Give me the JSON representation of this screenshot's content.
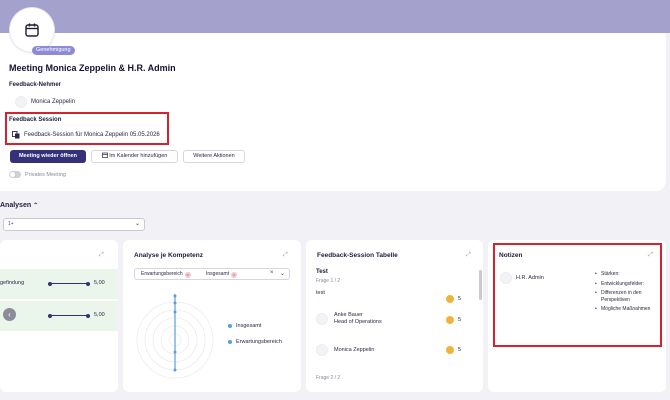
{
  "header": {
    "badge": "Genehmigung",
    "title": "Meeting Monica Zeppelin & H.R. Admin"
  },
  "recipient": {
    "label": "Feedback-Nehmer",
    "name": "Monica Zeppelin"
  },
  "session": {
    "label": "Feedback Session",
    "link_text": "Feedback-Session für Monica Zeppelin 05.05.2026"
  },
  "actions": {
    "reopen": "Meeting wieder öffnen",
    "calendar": "Im Kalender hinzufügen",
    "more": "Weitere Aktionen"
  },
  "private_toggle": {
    "label": "Privates Meeting",
    "checked": false
  },
  "analysis": {
    "title": "Analysen",
    "select_value": "1+",
    "panel1": {
      "rows": [
        {
          "label": "gefindung",
          "value": "5,00",
          "level": 1.0
        },
        {
          "label": "",
          "value": "5,00",
          "level": 1.0
        }
      ]
    },
    "panel2": {
      "title": "Analyse je Kompetenz",
      "tags": [
        "Erwartungsbereich",
        "Insgesamt"
      ],
      "legend": [
        "Insgesamt",
        "Erwartungsbereich"
      ]
    },
    "panel3": {
      "title": "Feedback-Session Tabelle",
      "question_title": "Test",
      "question_sub": "Frage 1 / 2",
      "question_text": "test",
      "top_score": "5",
      "responses": [
        {
          "name": "Anke Bauer",
          "role": "Head of Operations",
          "score": "5"
        },
        {
          "name": "Monica Zeppelin",
          "role": "",
          "score": "5"
        }
      ],
      "next_sub": "Frage 2 / 2"
    },
    "notes": {
      "title": "Notizen",
      "author": "H.R. Admin",
      "items": [
        "Stärken:",
        "Entwicklungsfelder:",
        "Differenzen in den Perspektiven",
        "Mögliche Maßnahmen"
      ]
    }
  },
  "colors": {
    "banner": "#a4a2cd",
    "primary": "#34317a",
    "highlight_red": "#d32330",
    "score_yellow": "#f0b43c",
    "chart_blue": "#5aa0d8",
    "green_row": "#eaf5ec"
  }
}
